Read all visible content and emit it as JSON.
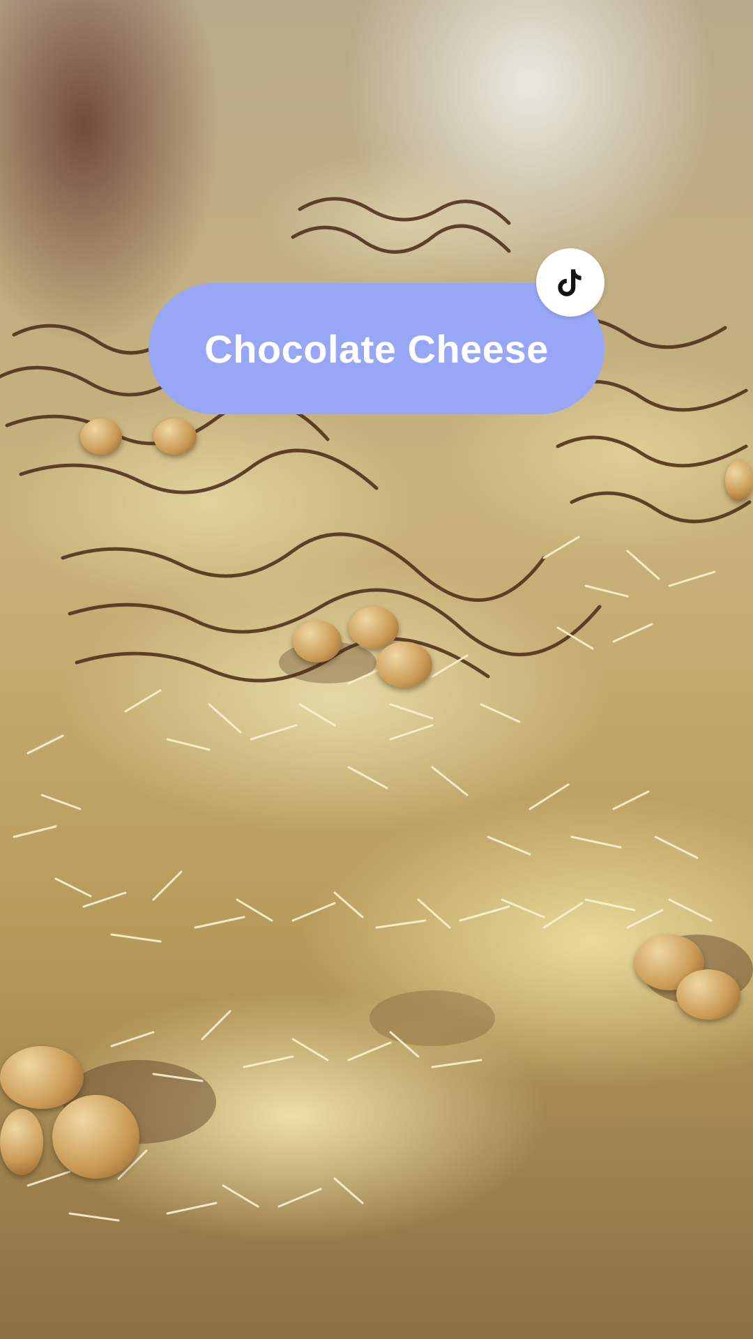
{
  "overlay": {
    "title": "Chocolate Cheese",
    "logo_icon": "tiktok-logo-icon",
    "pill_color": "#98a6f6",
    "text_color": "#ffffff"
  },
  "background": {
    "subject": "donuts-with-cheese-and-chocolate-image"
  }
}
